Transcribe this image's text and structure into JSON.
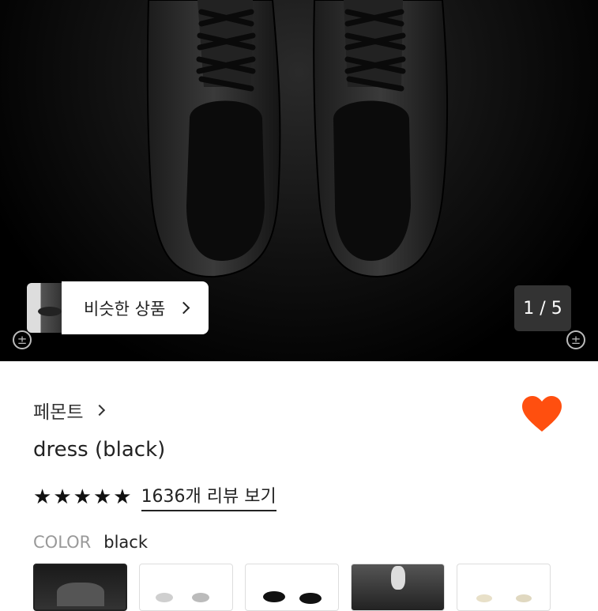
{
  "gallery": {
    "similar_label": "비슷한 상품",
    "counter": "1 / 5",
    "zoom_icon": "zoom-plusminus-icon"
  },
  "product": {
    "brand": "페몬트",
    "title": "dress (black)",
    "rating_stars": 5,
    "review_link": "1636개 리뷰 보기",
    "favorited": true,
    "accent_color": "#FF4F0F"
  },
  "options": {
    "color_key": "COLOR",
    "color_value": "black"
  }
}
